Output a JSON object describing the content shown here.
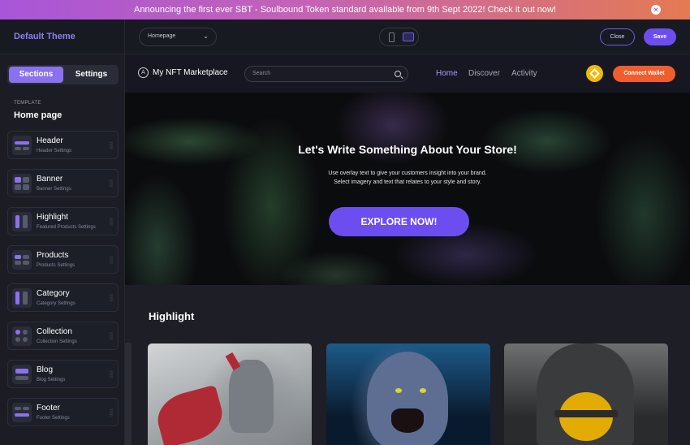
{
  "announcement": {
    "text": "Announcing the first ever SBT - Soulbound Token standard available from 9th Sept 2022! Check it out now!",
    "close_icon": "×"
  },
  "topbar": {
    "theme_title": "Default Theme",
    "page_select": "Homepage",
    "close_label": "Close",
    "save_label": "Save"
  },
  "sidebar": {
    "tabs": [
      "Sections",
      "Settings"
    ],
    "template_label": "TEMPLATE",
    "template_title": "Home page",
    "sections": [
      {
        "title": "Header",
        "subtitle": "Header Settings"
      },
      {
        "title": "Banner",
        "subtitle": "Banner Settings"
      },
      {
        "title": "Highlight",
        "subtitle": "Featured Products Settings"
      },
      {
        "title": "Products",
        "subtitle": "Products Settings"
      },
      {
        "title": "Category",
        "subtitle": "Category Settings"
      },
      {
        "title": "Collection",
        "subtitle": "Collection Settings"
      },
      {
        "title": "Blog",
        "subtitle": "Blog Settings"
      },
      {
        "title": "Footer",
        "subtitle": "Footer Settings"
      }
    ]
  },
  "preview": {
    "logo_text": "My NFT Marketplace",
    "search_placeholder": "Search",
    "nav": [
      "Home",
      "Discover",
      "Activity"
    ],
    "connect_label": "Connect Wallet",
    "banner": {
      "title": "Let's Write Something About Your Store!",
      "subtitle_line1": "Use overlay text to give your customers insight into your brand.",
      "subtitle_line2": "Select imagery and text that relates to your style and story.",
      "cta": "EXPLORE NOW!"
    },
    "highlight_title": "Highlight"
  },
  "colors": {
    "accent": "#6c4ef0",
    "connect": "#f05e2e",
    "active_nav": "#a99bff"
  }
}
